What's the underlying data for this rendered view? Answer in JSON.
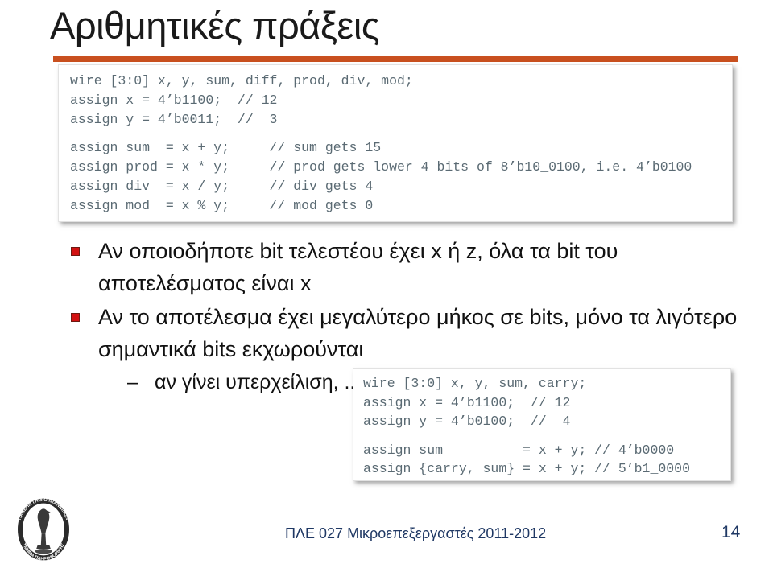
{
  "slide": {
    "title": "Αριθμητικές πράξεις",
    "accent_color": "#C9501F",
    "bullet_color": "#D21111",
    "footer_color": "#1F3864"
  },
  "code_block_1": {
    "lines": [
      "wire [3:0] x, y, sum, diff, prod, div, mod;",
      "assign x = 4’b1100;  // 12",
      "assign y = 4’b0011;  //  3",
      "",
      "assign sum  = x + y;     // sum gets 15",
      "assign prod = x * y;     // prod gets lower 4 bits of 8’b10_0100, i.e. 4’b0100",
      "assign div  = x / y;     // div gets 4",
      "assign mod  = x % y;     // mod gets 0"
    ]
  },
  "code_block_2": {
    "lines": [
      "wire [3:0] x, y, sum, carry;",
      "assign x = 4’b1100;  // 12",
      "assign y = 4’b0100;  //  4",
      "",
      "assign sum          = x + y; // 4’b0000",
      "assign {carry, sum} = x + y; // 5’b1_0000"
    ]
  },
  "bullets": [
    {
      "text": "Αν οποιοδήποτε bit τελεστέου έχει x ή z,  όλα τα bit του αποτελέσματος είναι x"
    },
    {
      "text": "Αν το αποτέλεσμα έχει μεγαλύτερο μήκος σε bits, μόνο τα λιγότερο σημαντικά bits εκχωρούνται",
      "sub": {
        "dash": "–",
        "text": "αν γίνει υπερχείλιση, ...."
      }
    }
  ],
  "footer": {
    "course": "ΠΛΕ 027 Μικροεπεξεργαστές  2011-2012",
    "slide_number": "14",
    "logo_outer_text": "ΠΑΝΕΠΙΣΤΗΜΙΟ ΙΩΑΝΝΙΝΩΝ",
    "logo_inner_text": "ΤΜΗΜΑ ΠΛΗΡΟΦΟΡΙΚΗΣ"
  }
}
